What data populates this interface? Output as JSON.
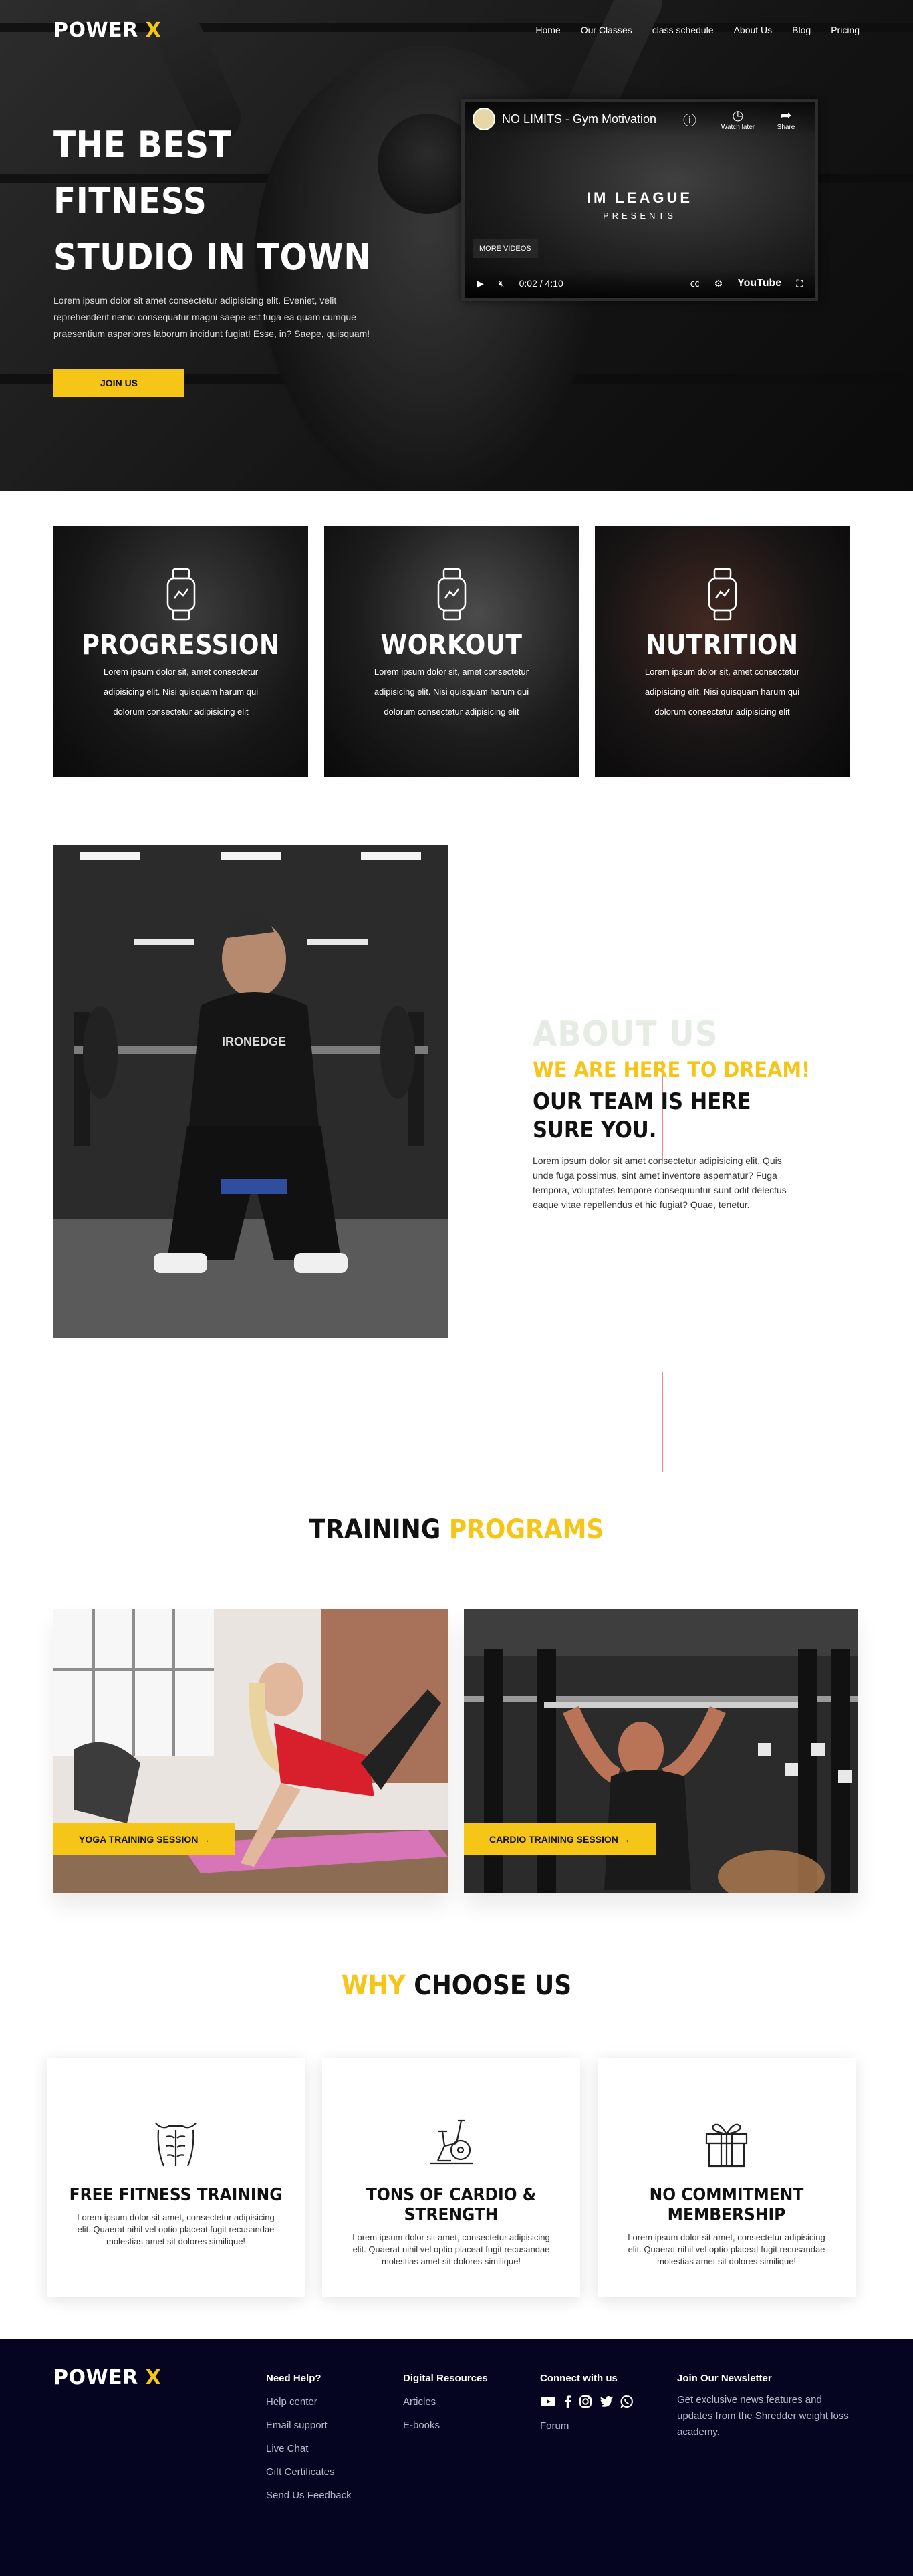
{
  "brand": {
    "name": "POWER",
    "mark": "X"
  },
  "nav": {
    "items": [
      "Home",
      "Our Classes",
      "class schedule",
      "About Us",
      "Blog",
      "Pricing"
    ]
  },
  "hero": {
    "title_line1": "THE BEST FITNESS",
    "title_line2": "STUDIO IN TOWN",
    "text": "Lorem ipsum dolor sit amet consectetur adipisicing elit. Eveniet, velit reprehenderit nemo consequatur magni saepe est fuga ea quam cumque praesentium asperiores laborum incidunt fugiat! Esse, in? Saepe, quisquam!",
    "cta": "JOIN US"
  },
  "video": {
    "title": "NO LIMITS - Gym Motivation",
    "watch_later": "Watch later",
    "share": "Share",
    "brand_line": "IM LEAGUE",
    "presents": "PRESENTS",
    "more_videos": "MORE VIDEOS",
    "time": "0:02 / 4:10",
    "platform": "YouTube"
  },
  "features": [
    {
      "title": "PROGRESSION",
      "text": "Lorem ipsum dolor sit, amet consectetur adipisicing elit. Nisi quisquam harum qui dolorum consectetur adipisicing elit"
    },
    {
      "title": "WORKOUT",
      "text": "Lorem ipsum dolor sit, amet consectetur adipisicing elit. Nisi quisquam harum qui dolorum consectetur adipisicing elit"
    },
    {
      "title": "NUTRITION",
      "text": "Lorem ipsum dolor sit, amet consectetur adipisicing elit. Nisi quisquam harum qui dolorum consectetur adipisicing elit"
    }
  ],
  "about": {
    "ghost": "ABOUT US",
    "tagline": "WE ARE HERE TO DREAM!",
    "heading": "OUR TEAM IS HERE SURE YOU.",
    "text": "Lorem ipsum dolor sit amet consectetur adipisicing elit. Quis unde fuga possimus, sint amet inventore aspernatur? Fuga tempora, voluptates tempore consequuntur sunt odit delectus eaque vitae repellendus et hic fugiat? Quae, tenetur.",
    "shirt_text": "IRONEDGE"
  },
  "training": {
    "title_dark": "TRAINING",
    "title_yellow": "PROGRAMS",
    "programs": [
      {
        "label": "YOGA TRAINING SESSION →"
      },
      {
        "label": "CARDIO TRAINING SESSION →"
      }
    ]
  },
  "why": {
    "title_yellow": "WHY",
    "title_dark": "CHOOSE US",
    "cards": [
      {
        "title": "FREE FITNESS TRAINING",
        "icon": "abs-icon",
        "text": "Lorem ipsum dolor sit amet, consectetur adipisicing elit. Quaerat nihil vel optio placeat fugit recusandae molestias amet sit dolores similique!"
      },
      {
        "title": "TONS OF CARDIO & STRENGTH",
        "icon": "exercise-bike-icon",
        "text": "Lorem ipsum dolor sit amet, consectetur adipisicing elit. Quaerat nihil vel optio placeat fugit recusandae molestias amet sit dolores similique!"
      },
      {
        "title": "NO COMMITMENT MEMBERSHIP",
        "icon": "gift-icon",
        "text": "Lorem ipsum dolor sit amet, consectetur adipisicing elit. Quaerat nihil vel optio placeat fugit recusandae molestias amet sit dolores similique!"
      }
    ]
  },
  "footer": {
    "help": {
      "title": "Need Help?",
      "links": [
        "Help center",
        "Email support",
        "Live Chat",
        "Gift Certificates",
        "Send Us Feedback"
      ]
    },
    "digital": {
      "title": "Digital Resources",
      "links": [
        "Articles",
        "E-books"
      ]
    },
    "connect": {
      "title": "Connect with us",
      "forum": "Forum"
    },
    "newsletter": {
      "title": "Join Our Newsletter",
      "text": "Get exclusive news,features and updates from the Shredder weight loss academy."
    }
  },
  "colors": {
    "accent": "#f5c518",
    "footer_bg": "#050522",
    "about_line": "#e38d8d"
  }
}
